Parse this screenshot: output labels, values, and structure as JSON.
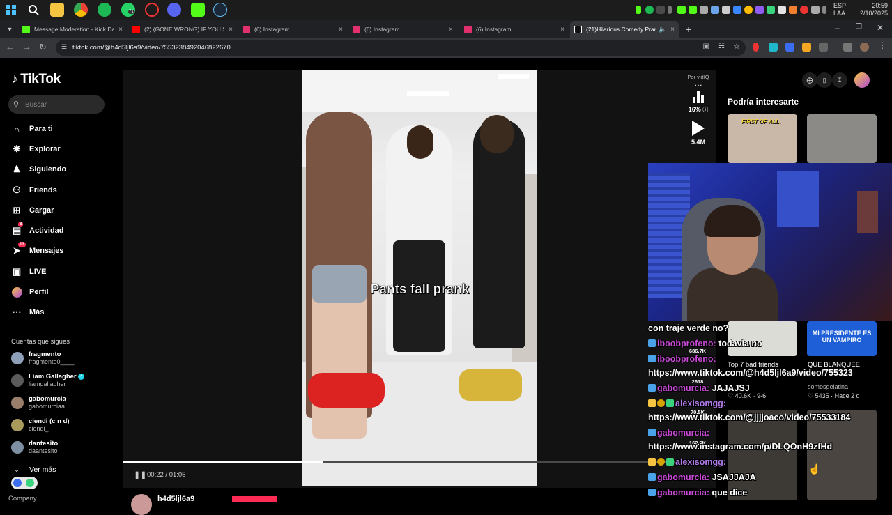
{
  "taskbar": {
    "lang_line1": "ESP",
    "lang_line2": "LAA",
    "time": "20:59",
    "date": "2/10/2025",
    "whatsapp_badge": "71"
  },
  "tabs": [
    {
      "title": "Message Moderation - Kick Da",
      "favicon_color": "#53fc18",
      "close": "×"
    },
    {
      "title": "(2) (GONE WRONG) IF YOU SE",
      "favicon_color": "#ff0000",
      "close": "×"
    },
    {
      "title": "(6) Instagram",
      "favicon_color": "#e1306c",
      "close": "×"
    },
    {
      "title": "(6) Instagram",
      "favicon_color": "#e1306c",
      "close": "×"
    },
    {
      "title": "(6) Instagram",
      "favicon_color": "#e1306c",
      "close": "×"
    },
    {
      "title": "(21)Hilarious Comedy Prank",
      "favicon_color": "#ffffff",
      "close": "×"
    }
  ],
  "new_tab": "+",
  "address": {
    "url": "tiktok.com/@h4d5ljl6a9/video/7553238492046822670"
  },
  "tiktok": {
    "logo": "TikTok",
    "search_placeholder": "Buscar",
    "nav": [
      {
        "label": "Para ti",
        "icon": "home-icon"
      },
      {
        "label": "Explorar",
        "icon": "compass-icon"
      },
      {
        "label": "Siguiendo",
        "icon": "following-icon"
      },
      {
        "label": "Friends",
        "icon": "friends-icon"
      },
      {
        "label": "Cargar",
        "icon": "upload-icon"
      },
      {
        "label": "Actividad",
        "icon": "activity-icon",
        "badge": "8"
      },
      {
        "label": "Mensajes",
        "icon": "messages-icon",
        "badge": "13"
      },
      {
        "label": "LIVE",
        "icon": "live-icon"
      },
      {
        "label": "Perfil",
        "icon": "profile-icon"
      },
      {
        "label": "Más",
        "icon": "more-icon"
      }
    ],
    "following_title": "Cuentas que sigues",
    "following": [
      {
        "name": "fragmento",
        "handle": "fragmento0____",
        "verified": false
      },
      {
        "name": "Liam Gallagher",
        "handle": "liamgallagher",
        "verified": true
      },
      {
        "name": "gabomurcia",
        "handle": "gabomurciaa",
        "verified": false
      },
      {
        "name": "ciendi (c n d)",
        "handle": "ciendi_",
        "verified": false
      },
      {
        "name": "dantesito",
        "handle": "daantesito",
        "verified": false
      }
    ],
    "see_more": "Ver más",
    "company": "Company"
  },
  "video": {
    "caption": "Pants fall prank",
    "time": "00:22 / 01:05",
    "progress": 0.338,
    "author": "h4d5ljl6a9"
  },
  "vidiq": {
    "label": "Por vidIQ",
    "percent": "16%",
    "views": "5.4M"
  },
  "side_stats": [
    "686.7K",
    "2618",
    "70.5K",
    "162.9K"
  ],
  "recommendations": {
    "title": "Podría interesarte",
    "thumb1_text": "FIRST OF ALL,",
    "cards": [
      {
        "title": "Top 7 bad friends",
        "likes": "40.6K",
        "date": "9-6"
      },
      {
        "title": "QUE BLANQUEE",
        "author": "somosgelatina",
        "likes": "5435",
        "date": "Hace 2 d",
        "thumb_text": "MI PRESIDENTE ES UN VAMPIRO"
      }
    ]
  },
  "chat": [
    {
      "user": "",
      "message": "con traje verde no?"
    },
    {
      "user": "iboobprofeno:",
      "message": "todavia no"
    },
    {
      "user": "iboobprofeno:",
      "message": ""
    },
    {
      "user": "",
      "message": "https://www.tiktok.com/@h4d5ljl6a9/video/755323"
    },
    {
      "user": "gabomurcia:",
      "message": "JAJAJSJ"
    },
    {
      "user": "alexisomgg:",
      "message": ""
    },
    {
      "user": "",
      "message": "https://www.tiktok.com/@jjjjoaco/video/75533184"
    },
    {
      "user": "gabomurcia:",
      "message": ""
    },
    {
      "user": "",
      "message": "https://www.instagram.com/p/DLQOnH9zfHd"
    },
    {
      "user": "alexisomgg:",
      "message": ""
    },
    {
      "user": "gabomurcia:",
      "message": "JSAJJAJA"
    },
    {
      "user": "gabomurcia:",
      "message": "que dice"
    }
  ],
  "colors": {
    "tiktok_red": "#fe2c55",
    "chat_user": "#c94ad7",
    "kick_green": "#53fc18"
  }
}
